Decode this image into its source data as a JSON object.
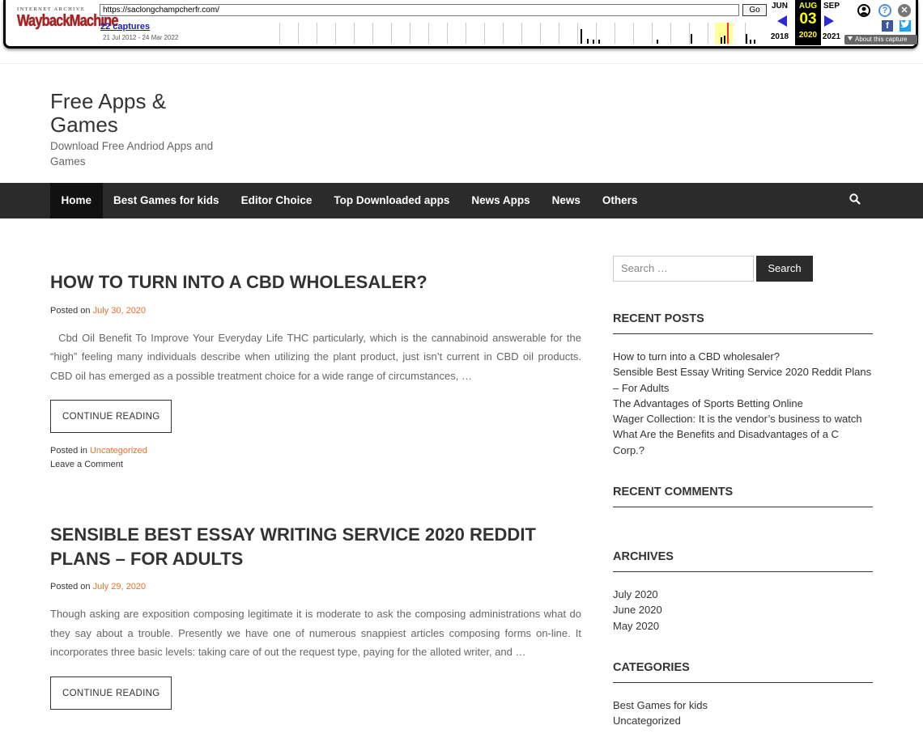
{
  "wayback": {
    "logo_top": "INTERNET ARCHIVE",
    "logo_main": "WaybackMachine",
    "url": "https://saclongchampcherfr.com/",
    "go_label": "Go",
    "captures": "22 captures",
    "range": "21 Jul 2012 - 24 Mar 2022",
    "prev_month": "JUN",
    "cur_month": "AUG",
    "next_month": "SEP",
    "cur_day": "03",
    "prev_year": "2018",
    "cur_year": "2020",
    "next_year": "2021",
    "about": "About this capture"
  },
  "site": {
    "title": "Free Apps & Games",
    "description": "Download Free Andriod Apps and Games"
  },
  "nav": {
    "items": [
      "Home",
      "Best Games for kids",
      "Editor Choice",
      "Top Downloaded apps",
      "News Apps",
      "News",
      "Others"
    ],
    "active": "Home"
  },
  "posts": [
    {
      "title": "How to turn into a CBD wholesaler?",
      "posted_on_label": "Posted on",
      "date": "July 30, 2020",
      "excerpt": "  Cbd Oil Benefit To Improve Your Everyday Life THC particularly, which is the cannabinoid answerable for the “high” feeling many individuals describe when utilizing the plant product, just isn’t current in CBD oil products. CBD oil has emerged as a possible treatment choice for a wide range of circumstances, …",
      "button": "CONTINUE READING",
      "posted_in_label": "Posted in",
      "category": "Uncategorized",
      "comment": "Leave a Comment"
    },
    {
      "title": "Sensible Best Essay Writing Service 2020 Reddit Plans – For Adults",
      "posted_on_label": "Posted on",
      "date": "July 29, 2020",
      "excerpt": "Though asking are exposition composing legitimate it is moderate to ask the composing administrations what do they say about a trouble. Presently we have one of numerous snappiest articles composing forms on-line. It incorporates three basic levels: taking care of out the request type, paying for the alloted writer, and …",
      "button": "CONTINUE READING"
    }
  ],
  "sidebar": {
    "search_placeholder": "Search …",
    "search_button": "Search",
    "recent_posts_title": "Recent Posts",
    "recent_posts": [
      "How to turn into a CBD wholesaler?",
      "Sensible Best Essay Writing Service 2020 Reddit Plans – For Adults",
      "The Advantages of Sports Betting Online",
      "Wager Collection: It is the vendor’s business to watch",
      "What Are the Benefits and Disadvantages of a C Corp.?"
    ],
    "recent_comments_title": "Recent Comments",
    "archives_title": "Archives",
    "archives": [
      "July 2020",
      "June 2020",
      "May 2020"
    ],
    "categories_title": "Categories",
    "categories": [
      "Best Games for kids",
      "Uncategorized"
    ]
  },
  "colors": {
    "accent": "#e86f2a",
    "nav_bg": "#2b2b2b",
    "wayback_red": "#b51d1d",
    "wayback_cur": "#ffff00"
  }
}
